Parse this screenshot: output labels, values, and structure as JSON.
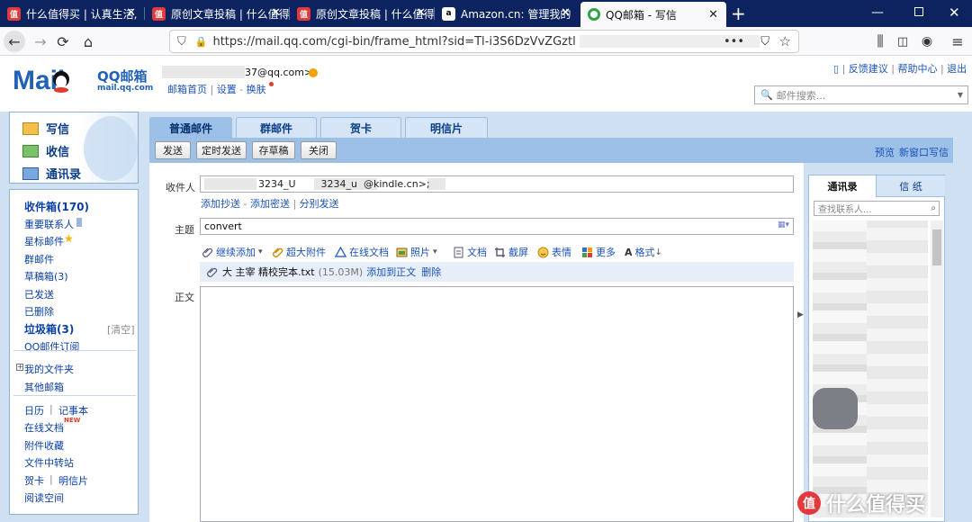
{
  "browser": {
    "tabs": [
      {
        "title": "什么值得买 | 认真生活,",
        "icon": "smzdm-icon",
        "active": false
      },
      {
        "title": "原创文章投稿 | 什么值得",
        "icon": "smzdm-icon",
        "active": false
      },
      {
        "title": "原创文章投稿 | 什么值得",
        "icon": "smzdm-icon",
        "active": false
      },
      {
        "title": "Amazon.cn: 管理我的",
        "icon": "amazon-icon",
        "active": false
      },
      {
        "title": "QQ邮箱 - 写信",
        "icon": "qqmail-icon",
        "active": true
      }
    ],
    "new_tab": "+",
    "url": "https://mail.qq.com/cgi-bin/frame_html?sid=Tl-i3S6DzVvZGztl",
    "window_controls": [
      "minimize",
      "restore",
      "close"
    ]
  },
  "header": {
    "logo_text": "QQ邮箱",
    "logo_domain": "mail.qq.com",
    "user_email": "37@qq.com>",
    "links": {
      "home": "邮箱首页",
      "settings": "设置",
      "skin": "换肤"
    },
    "right_links": {
      "feedback": "反馈建议",
      "help": "帮助中心",
      "logout": "退出"
    },
    "search_placeholder": "邮件搜索..."
  },
  "left": {
    "top_actions": {
      "compose": "写信",
      "inbox": "收信",
      "contacts": "通讯录"
    },
    "folders": {
      "inbox": "收件箱(170)",
      "important": "重要联系人",
      "starred": "星标邮件",
      "group": "群邮件",
      "drafts": "草稿箱(3)",
      "sent": "已发送",
      "deleted": "已删除",
      "spam": "垃圾箱(3)",
      "spam_clear": "[清空]",
      "subscriptions": "QQ邮件订阅",
      "my_folders": "我的文件夹",
      "other_mail": "其他邮箱"
    },
    "tools": {
      "calendar": "日历",
      "notes": "记事本",
      "docs": "在线文档",
      "new_badge": "NEW",
      "attachments": "附件收藏",
      "transfer": "文件中转站",
      "card": "贺卡",
      "postcard": "明信片",
      "reading": "阅读空间"
    }
  },
  "compose": {
    "tabs": [
      "普通邮件",
      "群邮件",
      "贺卡",
      "明信片"
    ],
    "toolbar": {
      "send": "发送",
      "schedule": "定时发送",
      "save": "存草稿",
      "close": "关闭"
    },
    "top_right": {
      "preview": "预览",
      "new_window": "新窗口写信"
    },
    "to_label": "收件人",
    "recipients": "3234_U        3234_u  @kindle.cn>;",
    "add_cc": "添加抄送",
    "add_bcc": "添加密送",
    "separate_send": "分别发送",
    "subject_label": "主题",
    "subject_value": "convert",
    "tools": {
      "continue_add": "继续添加",
      "large_attach": "超大附件",
      "online_doc": "在线文档",
      "photo": "照片",
      "document": "文档",
      "screenshot": "截屏",
      "emoji": "表情",
      "more": "更多",
      "format": "格式"
    },
    "attachment": {
      "name": "大 主宰 精校完本.txt",
      "size": "(15.03M)",
      "add_to_body": "添加到正文",
      "delete": "删除"
    },
    "body_label": "正文"
  },
  "right": {
    "tabs": {
      "contacts": "通讯录",
      "stationery": "信 纸"
    },
    "search_placeholder": "查找联系人..."
  },
  "watermark": {
    "text": "什么值得买"
  }
}
